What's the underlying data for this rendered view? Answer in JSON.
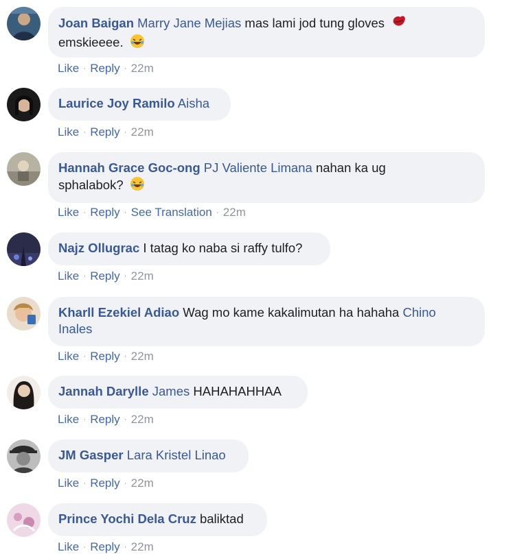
{
  "comments": [
    {
      "author": "Joan Baigan",
      "mention": "Marry Jane Mejias",
      "text": "mas lami jod tung gloves",
      "text2": "emskieeee.",
      "actions": {
        "like": "Like",
        "reply": "Reply",
        "time": "22m"
      }
    },
    {
      "author": "Laurice Joy Ramilo",
      "mention": "Aisha",
      "actions": {
        "like": "Like",
        "reply": "Reply",
        "time": "22m"
      }
    },
    {
      "author": "Hannah Grace Goc-ong",
      "mention": "PJ Valiente Limana",
      "text": "nahan ka ug",
      "text2": "sphalabok?",
      "actions": {
        "like": "Like",
        "reply": "Reply",
        "translate": "See Translation",
        "time": "22m"
      }
    },
    {
      "author": "Najz Ollugrac",
      "text": "I tatag ko naba si raffy tulfo?",
      "actions": {
        "like": "Like",
        "reply": "Reply",
        "time": "22m"
      }
    },
    {
      "author": "Kharll Ezekiel Adiao",
      "text": "Wag mo kame kakalimutan ha hahaha",
      "mention": "Chino",
      "mention2": "Inales",
      "actions": {
        "like": "Like",
        "reply": "Reply",
        "time": "22m"
      }
    },
    {
      "author": "Jannah Darylle",
      "mention": "James",
      "text": "HAHAHAHHAA",
      "actions": {
        "like": "Like",
        "reply": "Reply",
        "time": "22m"
      }
    },
    {
      "author": "JM Gasper",
      "mention": "Lara Kristel Linao",
      "actions": {
        "like": "Like",
        "reply": "Reply",
        "time": "22m"
      }
    },
    {
      "author": "Prince Yochi Dela Cruz",
      "text": "baliktad",
      "actions": {
        "like": "Like",
        "reply": "Reply",
        "time": "22m"
      }
    }
  ]
}
